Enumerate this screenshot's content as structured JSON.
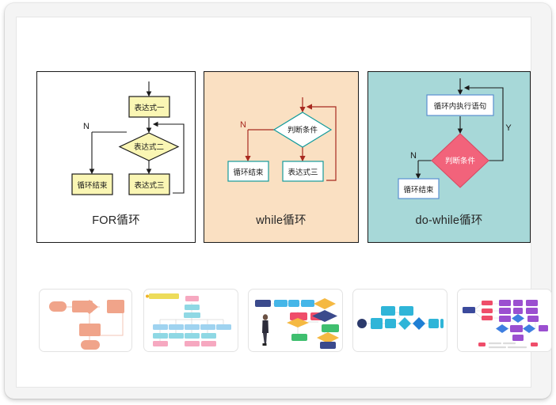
{
  "window": {
    "background": "#f4f4f4",
    "sheet_background": "#ffffff"
  },
  "panels": [
    {
      "id": "for",
      "title": "FOR循环",
      "background": "#ffffff",
      "border_color": "#1a1a1a",
      "node_fill": "#faf6b4",
      "node_stroke": "#1a1a1a",
      "connector_color": "#1a1a1a",
      "nodes": [
        {
          "id": "expr1",
          "shape": "rect",
          "label": "表达式一"
        },
        {
          "id": "expr2",
          "shape": "diamond",
          "label": "表达式二"
        },
        {
          "id": "end",
          "shape": "rect",
          "label": "循环结束"
        },
        {
          "id": "expr3",
          "shape": "rect",
          "label": "表达式三"
        }
      ],
      "edge_labels": [
        "N"
      ]
    },
    {
      "id": "while",
      "title": "while循环",
      "background": "#fae0c2",
      "border_color": "#1a1a1a",
      "node_fill": "#ffffff",
      "node_stroke": "#149b9b",
      "connector_color": "#a82a20",
      "nodes": [
        {
          "id": "cond",
          "shape": "diamond",
          "label": "判断条件"
        },
        {
          "id": "end",
          "shape": "rect",
          "label": "循环结束"
        },
        {
          "id": "expr3",
          "shape": "rect",
          "label": "表达式三"
        }
      ],
      "edge_labels": [
        "N"
      ]
    },
    {
      "id": "dowhile",
      "title": "do-while循环",
      "background": "#a7d8d8",
      "border_color": "#1a1a1a",
      "node_fill": "#ffffff",
      "node_stroke": "#5b8fd0",
      "diamond_fill": "#f2637b",
      "connector_color": "#1a1a1a",
      "nodes": [
        {
          "id": "body",
          "shape": "rect",
          "label": "循环内执行语句"
        },
        {
          "id": "cond",
          "shape": "diamond",
          "label": "判断条件"
        },
        {
          "id": "end",
          "shape": "rect",
          "label": "循环结束"
        }
      ],
      "edge_labels": [
        "N",
        "Y"
      ]
    }
  ],
  "thumbnails": [
    {
      "id": "thumb-flow-salmon",
      "name": "flowchart-preview-salmon",
      "accent": "#f0a48a"
    },
    {
      "id": "thumb-flow-cyan",
      "name": "flowchart-preview-cyan",
      "accent": "#7dd3dd"
    },
    {
      "id": "thumb-flow-person",
      "name": "flowchart-preview-person",
      "accent": "#f5b942"
    },
    {
      "id": "thumb-flow-blue",
      "name": "flowchart-preview-blue",
      "accent": "#29a8e0"
    },
    {
      "id": "thumb-flow-purple",
      "name": "flowchart-preview-purple",
      "accent": "#9b4fd0"
    }
  ]
}
